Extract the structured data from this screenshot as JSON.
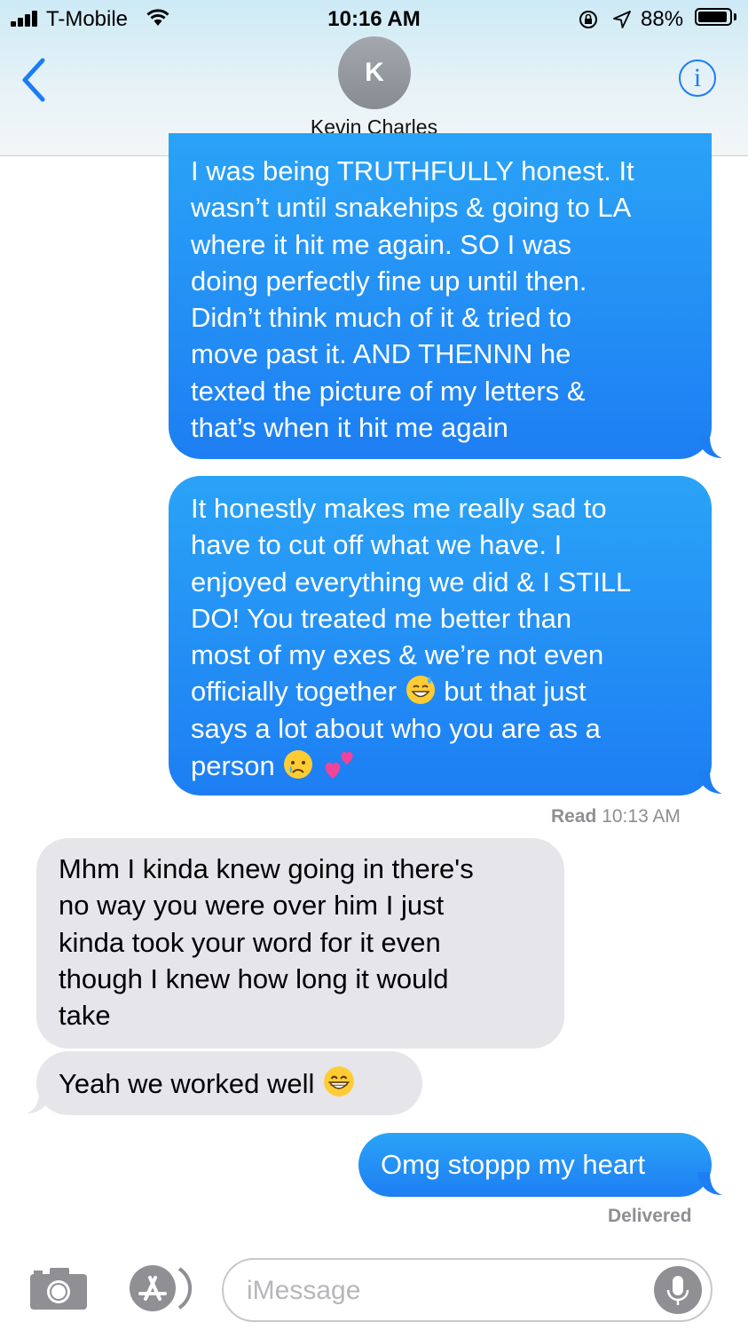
{
  "status_bar": {
    "carrier": "T-Mobile",
    "time": "10:16 AM",
    "battery": "88%"
  },
  "contact": {
    "initial": "K",
    "name": "Kevin Charles"
  },
  "messages": [
    {
      "direction": "sent",
      "text": "I was being TRUTHFULLY honest. It\nwasn’t until snakehips & going to LA\nwhere it hit me again. SO I was\ndoing perfectly fine up until then.\nDidn’t think much of it & tried to\nmove past it. AND THENNN he\ntexted the picture of my letters &\nthat’s when it hit me again"
    },
    {
      "direction": "sent",
      "text_a": "It honestly makes me really sad to\nhave to cut off what we have. I\nenjoyed everything we did & I STILL\nDO! You treated me better than\nmost of my exes & we’re not even\nofficially together",
      "text_b": " but that just\nsays a lot about who you are as a\nperson",
      "emojis": [
        "sweat-smile-emoji",
        "crying-emoji",
        "two-hearts-emoji"
      ]
    },
    {
      "direction": "received",
      "text": " Mhm I kinda knew going in there's\nno way you were over him I just\nkinda took your word for it even\nthough I knew how long it would\ntake"
    },
    {
      "direction": "received",
      "text": "Yeah we worked well",
      "emojis": [
        "grinning-emoji"
      ]
    },
    {
      "direction": "sent",
      "text": "Omg stoppp my heart"
    }
  ],
  "receipts": {
    "read_label": "Read",
    "read_time": "10:13 AM",
    "delivered": "Delivered"
  },
  "input": {
    "placeholder": "iMessage"
  },
  "colors": {
    "sent_bubble": "#1d8ef5",
    "received_bubble": "#e5e5ea",
    "accent": "#1b7cf7"
  }
}
